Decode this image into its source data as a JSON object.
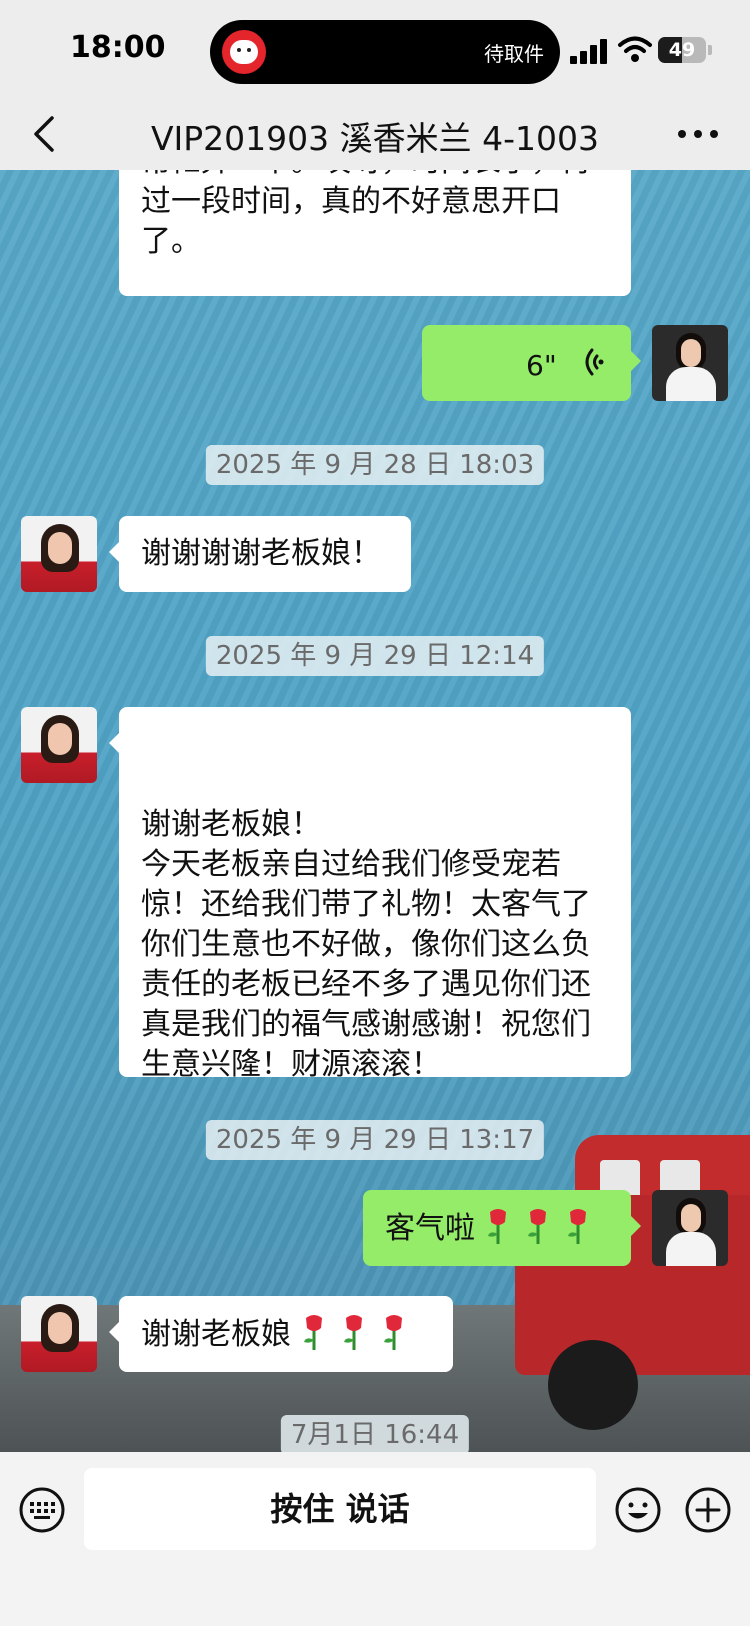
{
  "status_bar": {
    "time": "18:00",
    "island_label": "待取件",
    "battery": "49"
  },
  "header": {
    "title": "VIP201903 溪香米兰 4-1003"
  },
  "messages": [
    {
      "side": "left-partial",
      "text": "常忙弄一下。哎呀，时间长了，再过一段时间，真的不好意思开口了。"
    },
    {
      "side": "right",
      "type": "voice",
      "duration": "6\""
    },
    {
      "type": "time",
      "text": "2025 年 9 月 28 日 18:03"
    },
    {
      "side": "left",
      "text": "谢谢谢谢老板娘！"
    },
    {
      "type": "time",
      "text": "2025 年 9 月 29 日 12:14"
    },
    {
      "side": "left",
      "text": "谢谢老板娘！\n今天老板亲自过给我们修受宠若惊！还给我们带了礼物！太客气了你们生意也不好做，像你们这么负责任的老板已经不多了遇见你们还真是我们的福气感谢感谢！祝您们生意兴隆！财源滚滚！"
    },
    {
      "type": "time",
      "text": "2025 年 9 月 29 日 13:17"
    },
    {
      "side": "right",
      "text": "客气啦"
    },
    {
      "side": "left",
      "text": "谢谢老板娘"
    },
    {
      "type": "time",
      "text": "7月1日 16:44"
    }
  ],
  "input_bar": {
    "talk_label": "按住 说话"
  },
  "colors": {
    "sent_bubble": "#95ec69",
    "received_bubble": "#ffffff",
    "chat_background": "#55a6c7"
  },
  "icons": [
    "back-icon",
    "more-icon",
    "voice-icon",
    "rose-icon",
    "keyboard-icon",
    "emoji-icon",
    "plus-icon"
  ]
}
